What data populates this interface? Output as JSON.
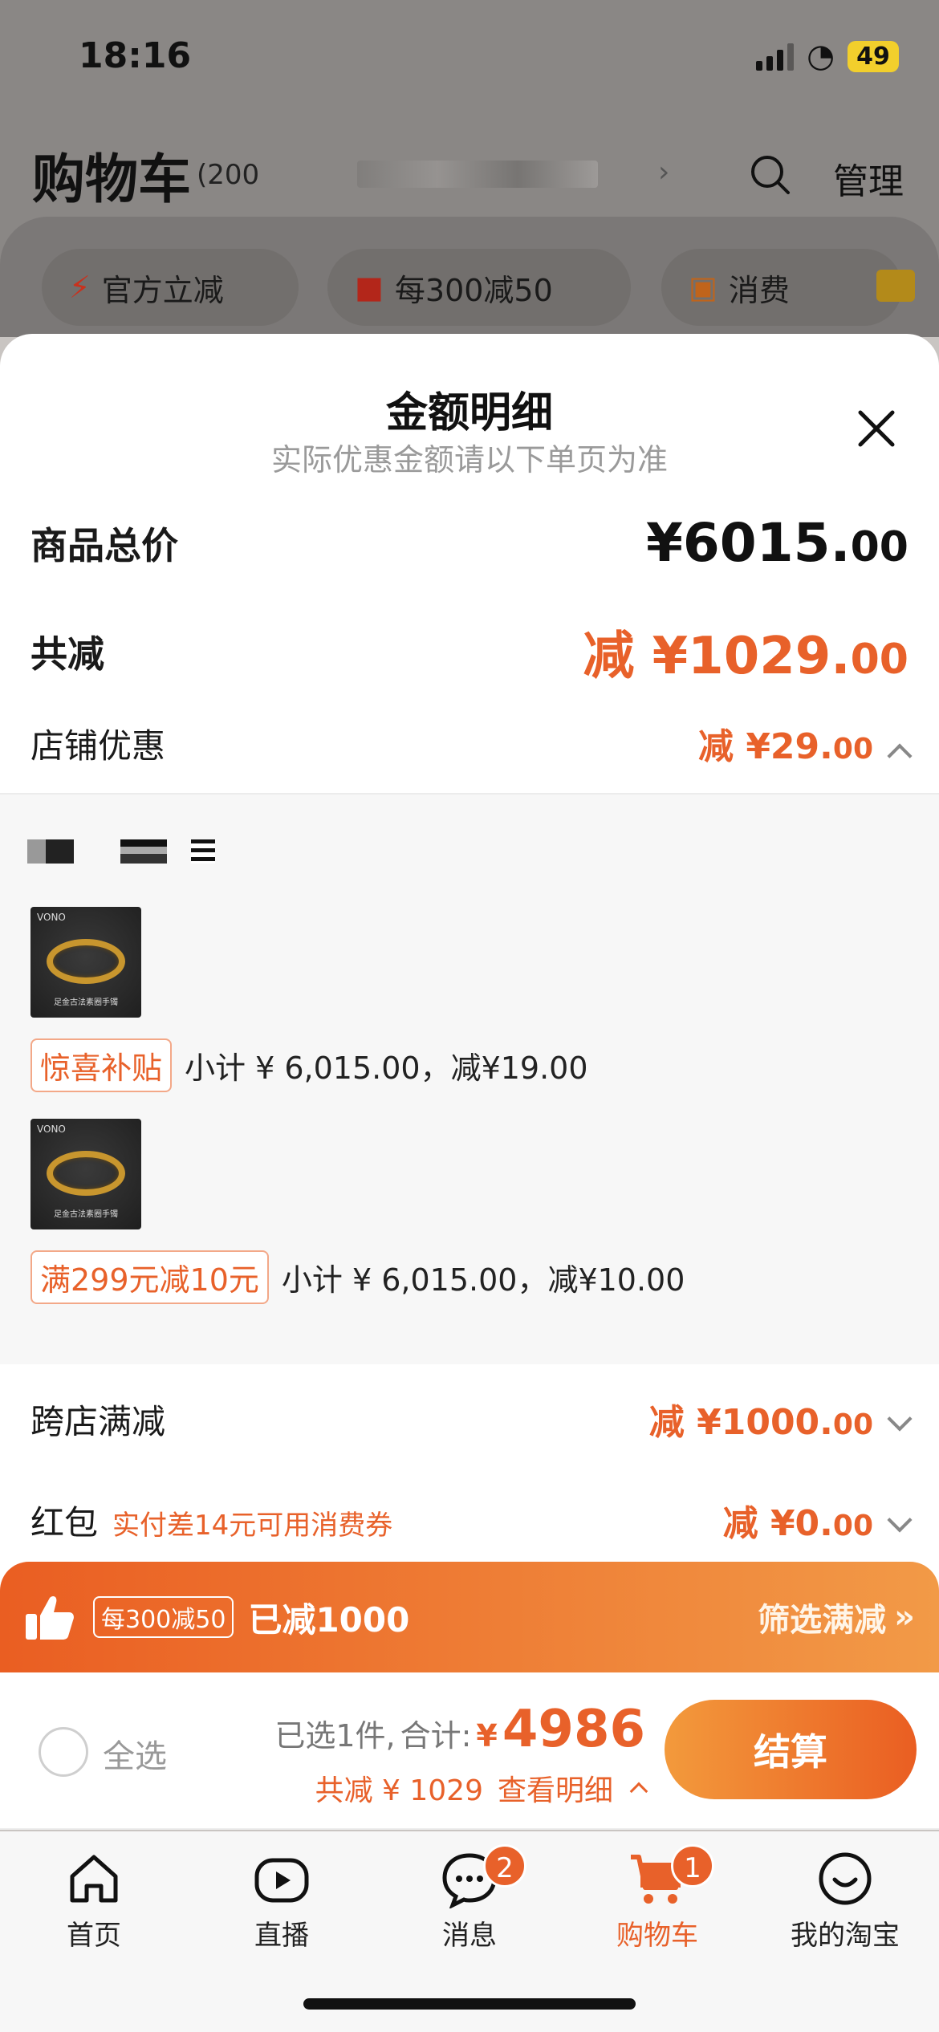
{
  "status": {
    "time": "18:16",
    "battery": "49"
  },
  "cart": {
    "title": "购物车",
    "count": "(200",
    "manage": "管理",
    "chips": [
      {
        "label": "官方立减",
        "icon": "lightning-icon"
      },
      {
        "label": "每300减50",
        "icon": "shop-icon"
      },
      {
        "label": "消费",
        "icon": "coupon-icon"
      }
    ]
  },
  "sheet": {
    "title": "金额明细",
    "subtitle": "实际优惠金额请以下单页为准",
    "total_label": "商品总价",
    "total_int": "¥6015.",
    "total_dec": "00",
    "minus_label": "共减",
    "minus_int": "减 ¥1029.",
    "minus_dec": "00",
    "shop_label": "店铺优惠",
    "shop_int": "减 ¥29.",
    "shop_dec": "00",
    "items": [
      {
        "brand": "VONO",
        "caption": "足金古法素圈手镯",
        "tag": "惊喜补贴",
        "text": "小计 ¥ 6,015.00，减¥19.00"
      },
      {
        "brand": "VONO",
        "caption": "足金古法素圈手镯",
        "tag": "满299元减10元",
        "text": "小计 ¥ 6,015.00，减¥10.00"
      }
    ],
    "cross_label": "跨店满减",
    "cross_int": "减 ¥1000.",
    "cross_dec": "00",
    "red_label": "红包",
    "red_hint": "实付差14元可用消费券",
    "red_int": "减 ¥0.",
    "red_dec": "00"
  },
  "promo_bar": {
    "tag": "每300减50",
    "done": "已减1000",
    "filter": "筛选满减",
    "filter_arrow": "»"
  },
  "checkout": {
    "select_all": "全选",
    "selected": "已选1件,",
    "total_label": "合计:",
    "currency": "¥",
    "total": "4986",
    "saved": "共减 ¥ 1029",
    "detail": "查看明细",
    "button": "结算"
  },
  "tabs": [
    {
      "label": "首页",
      "icon": "home-icon"
    },
    {
      "label": "直播",
      "icon": "live-play-icon"
    },
    {
      "label": "消息",
      "icon": "message-icon",
      "badge": "2"
    },
    {
      "label": "购物车",
      "icon": "cart-icon",
      "badge": "1",
      "active": true
    },
    {
      "label": "我的淘宝",
      "icon": "profile-smile-icon"
    }
  ],
  "colors": {
    "accent": "#e8612a",
    "gradient_start": "#ea5e22",
    "gradient_end": "#f29a47"
  }
}
